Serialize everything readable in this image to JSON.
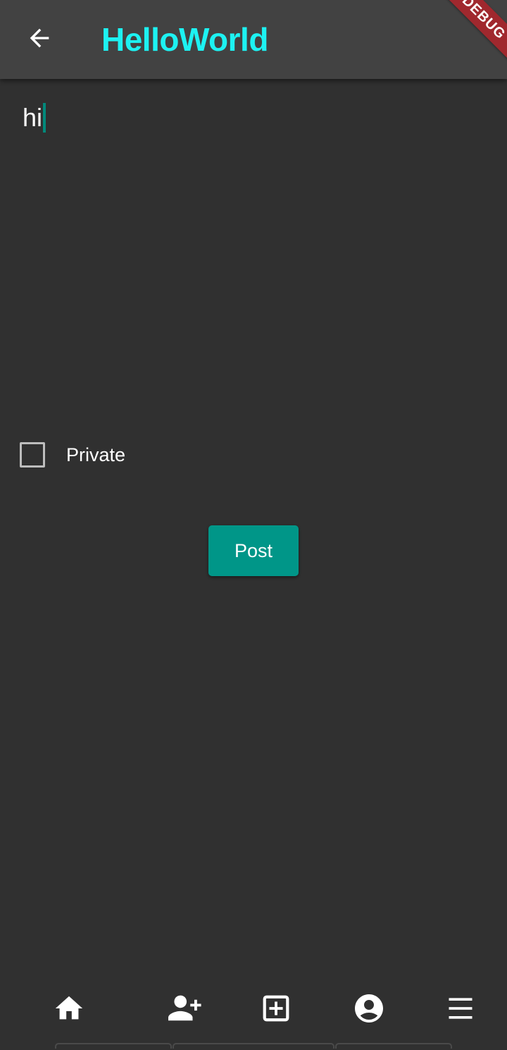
{
  "app_bar": {
    "title": "HelloWorld",
    "back_icon": "arrow-back-icon",
    "title_color": "#1DF2F2",
    "background": "#424242"
  },
  "debug_banner": {
    "label": "DEBUG"
  },
  "post_form": {
    "text_value": "hi",
    "private_label": "Private",
    "private_checked": false,
    "post_label": "Post",
    "accent_color": "#009688"
  },
  "bottom_nav": {
    "items": [
      {
        "icon": "home-icon"
      },
      {
        "icon": "person-add-icon"
      },
      {
        "icon": "add-box-icon"
      },
      {
        "icon": "account-circle-icon"
      },
      {
        "icon": "menu-icon"
      }
    ]
  }
}
